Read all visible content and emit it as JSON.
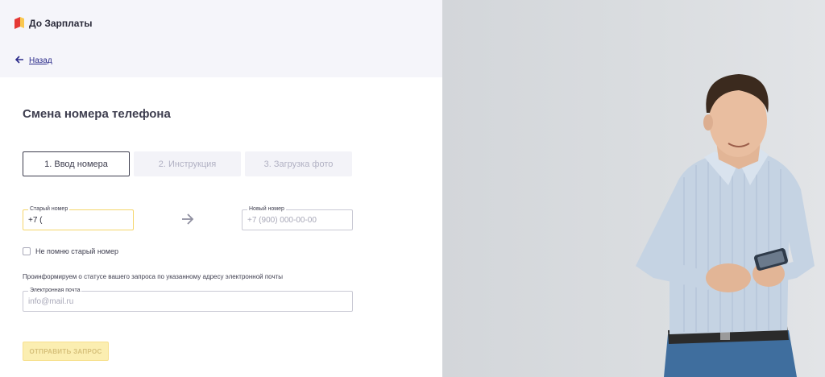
{
  "brand": {
    "name": "До Зарплаты"
  },
  "nav": {
    "back_label": "Назад"
  },
  "page": {
    "title": "Смена номера телефона"
  },
  "steps": [
    {
      "label": "1. Ввод номера"
    },
    {
      "label": "2. Инструкция"
    },
    {
      "label": "3. Загрузка фото"
    }
  ],
  "form": {
    "old_number": {
      "label": "Старый номер",
      "value": "+7 ("
    },
    "new_number": {
      "label": "Новый номер",
      "placeholder": "+7 (900) 000-00-00"
    },
    "forgot_checkbox_label": "Не помню старый номер",
    "info_text": "Проинформируем о статусе вашего запроса по указанному адресу электронной почты",
    "email": {
      "label": "Электронная почта",
      "placeholder": "info@mail.ru"
    },
    "submit_label": "Отправить запрос"
  },
  "colors": {
    "accent_yellow": "#f5d66b",
    "link_blue": "#2b2b8a",
    "logo_red": "#e53935",
    "logo_yellow": "#f9c74f"
  }
}
